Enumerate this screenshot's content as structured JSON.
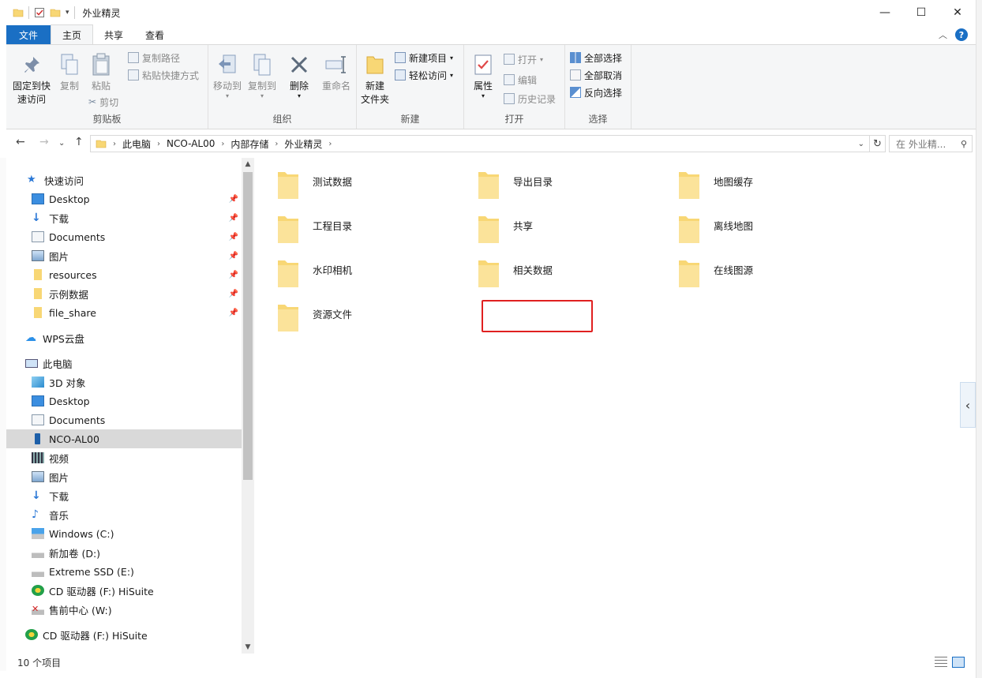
{
  "window": {
    "title": "外业精灵",
    "controls": {
      "minimize": "—",
      "maximize": "☐",
      "close": "✕"
    }
  },
  "ribbon_tabs": [
    "文件",
    "主页",
    "共享",
    "查看"
  ],
  "ribbon": {
    "clipboard": {
      "label": "剪贴板",
      "pin": "固定到快\n速访问",
      "pin_line1": "固定到快",
      "pin_line2": "速访问",
      "copy": "复制",
      "paste": "粘贴",
      "copy_path": "复制路径",
      "paste_shortcut": "粘贴快捷方式",
      "cut": "剪切"
    },
    "organize": {
      "label": "组织",
      "move_to": "移动到",
      "copy_to": "复制到",
      "delete": "删除",
      "rename": "重命名"
    },
    "new": {
      "label": "新建",
      "new_folder_line1": "新建",
      "new_folder_line2": "文件夹",
      "new_item": "新建项目",
      "easy_access": "轻松访问"
    },
    "open": {
      "label": "打开",
      "properties": "属性",
      "open": "打开",
      "edit": "编辑",
      "history": "历史记录"
    },
    "select": {
      "label": "选择",
      "select_all": "全部选择",
      "select_none": "全部取消",
      "invert": "反向选择"
    }
  },
  "address": {
    "crumbs": [
      "此电脑",
      "NCO-AL00",
      "内部存储",
      "外业精灵"
    ],
    "search_placeholder": "在 外业精..."
  },
  "nav": {
    "quick_access": "快速访问",
    "quick_items": [
      "Desktop",
      "下载",
      "Documents",
      "图片",
      "resources",
      "示例数据",
      "file_share"
    ],
    "wps": "WPS云盘",
    "this_pc": "此电脑",
    "pc_items": [
      "3D 对象",
      "Desktop",
      "Documents",
      "NCO-AL00",
      "视频",
      "图片",
      "下载",
      "音乐",
      "Windows (C:)",
      "新加卷 (D:)",
      "Extreme SSD (E:)",
      "CD 驱动器 (F:) HiSuite",
      "售前中心 (W:)"
    ],
    "cd_drive": "CD 驱动器 (F:) HiSuite"
  },
  "folders": [
    "测试数据",
    "导出目录",
    "地图缓存",
    "工程目录",
    "共享",
    "离线地图",
    "水印相机",
    "相关数据",
    "在线图源",
    "资源文件"
  ],
  "status": {
    "count": "10 个项目"
  },
  "colors": {
    "accent": "#1a6fc4",
    "folder": "#f8d775",
    "selection": "#cce8ff",
    "highlight_box": "#e02020"
  }
}
